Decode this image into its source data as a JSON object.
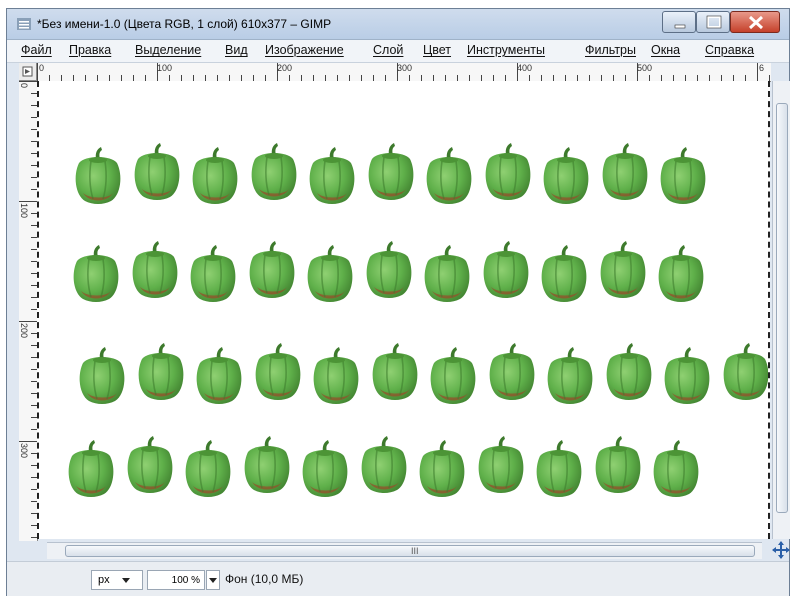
{
  "window": {
    "title": "*Без имени-1.0 (Цвета RGB, 1 слой) 610x377 – GIMP"
  },
  "menu": [
    "Файл",
    "Правка",
    "Выделение",
    "Вид",
    "Изображение",
    "Слой",
    "Цвет",
    "Инструменты",
    "Фильтры",
    "Окна",
    "Справка"
  ],
  "ruler": {
    "horizontal": [
      "0",
      "100",
      "200",
      "300",
      "400",
      "500",
      "6"
    ],
    "vertical": [
      "0",
      "100",
      "200",
      "300"
    ]
  },
  "canvas": {
    "content": "pepper-pattern",
    "pepper_rows": [
      11,
      11,
      12,
      11
    ]
  },
  "statusbar": {
    "unit": "px",
    "zoom": "100 %",
    "layer_info": "Фон (10,0 МБ)"
  },
  "scroll": {
    "h_grip": "III"
  },
  "colors": {
    "pepper_green": "#5fb04a",
    "pepper_dark": "#3f7f2e",
    "pepper_red": "#9a4a2a",
    "titlebar": "#c4d5ea",
    "close_button": "#c5412b"
  },
  "icons": [
    "gimp-window-icon",
    "minimize-icon",
    "maximize-icon",
    "close-icon",
    "chevron-down-icon",
    "navigate-cross-icon",
    "quick-mask-icon"
  ]
}
